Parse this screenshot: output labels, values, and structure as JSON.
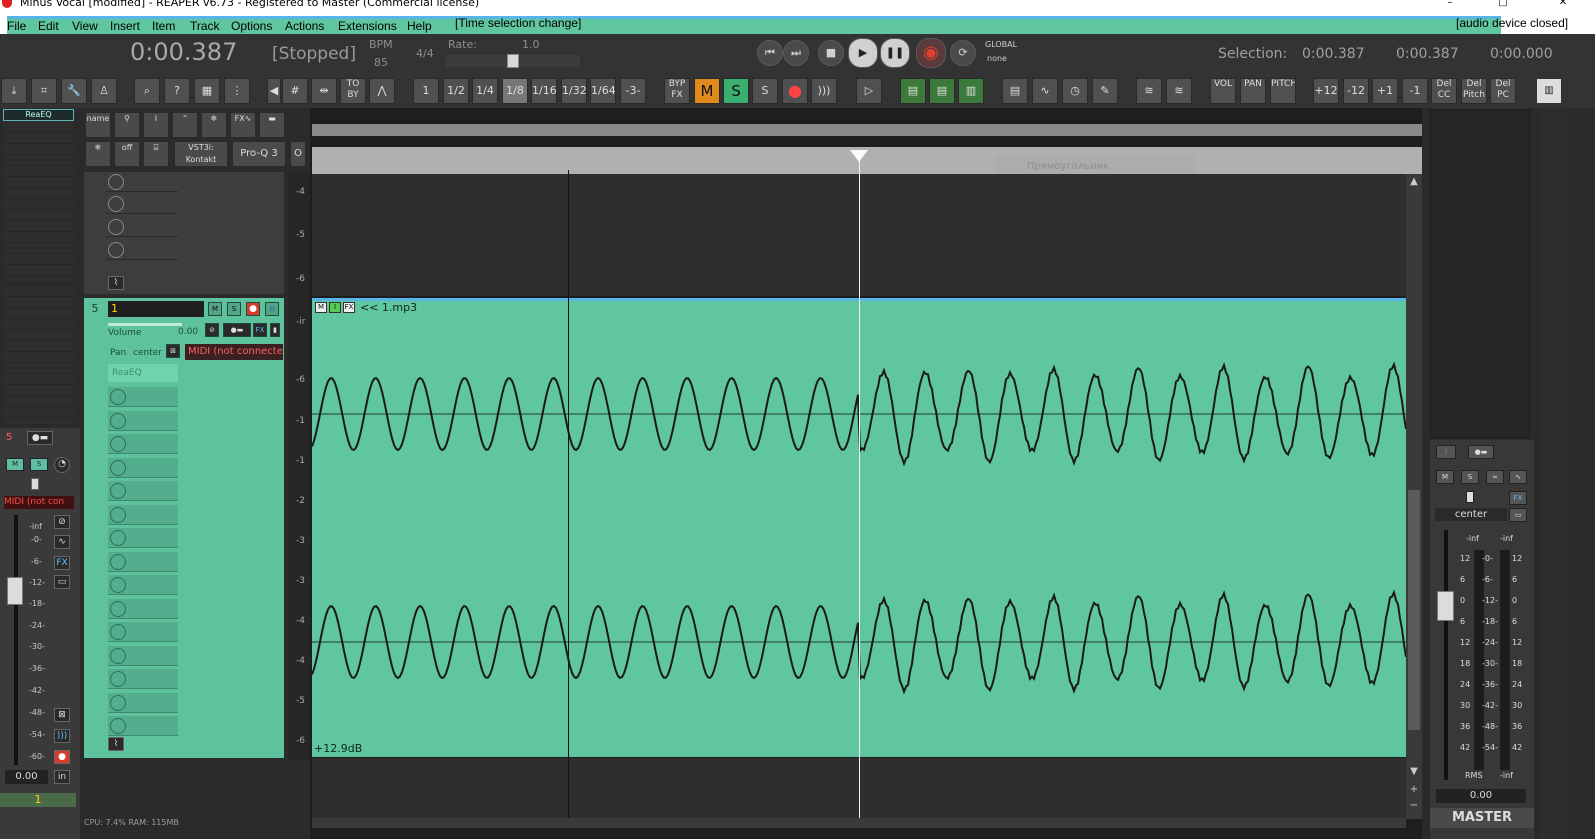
{
  "window": {
    "title": "Minus Vocal [modified] - REAPER v6.73 - Registered to Master (Commercial license)"
  },
  "menu": {
    "items": [
      "File",
      "Edit",
      "View",
      "Insert",
      "Item",
      "Track",
      "Options",
      "Actions",
      "Extensions",
      "Help"
    ],
    "status_left": "[Time selection change]",
    "status_right": "[audio device closed]"
  },
  "transport": {
    "time": "0:00.387",
    "state": "[Stopped]",
    "bpm_label": "BPM",
    "bpm": "85",
    "timesig": "4/4",
    "rate_label": "Rate:",
    "rate": "1.0",
    "global_label": "GLOBAL",
    "global_mode": "none",
    "selection_label": "Selection:",
    "selection_start": "0:00.387",
    "selection_end": "0:00.387",
    "selection_len": "0:00.000"
  },
  "toolbar": {
    "grid": [
      "1",
      "1/2",
      "1/4",
      "1/8",
      "1/16",
      "1/32",
      "1/64"
    ],
    "selected_grid": "1/8",
    "triplet": "-3-",
    "to_by": "TO BY",
    "byp": "BYP FX",
    "mute_all": "M",
    "solo_all": "S",
    "solo_excl": "S",
    "vol_label": "VOL",
    "pan_label": "PAN",
    "pitch_label": "PITCH",
    "pitch_buttons": [
      "+12",
      "-12",
      "+1",
      "-1"
    ],
    "del_buttons": [
      "Del CC",
      "Del Pitch",
      "Del PC"
    ]
  },
  "left_mixer": {
    "fx_slot": "ReaEQ",
    "track_number": "5",
    "midi_text": "MIDI (not con",
    "scale": [
      "-inf",
      "-0-",
      "-6-",
      "-12-",
      "-18-",
      "-24-",
      "-30-",
      "-36-",
      "-42-",
      "-48-",
      "-54-",
      "-60-"
    ],
    "volume": "0.00",
    "in_label": "in",
    "track_name": "1"
  },
  "tcp": {
    "name_label": "name",
    "vst_label": "VST3i: Kontakt",
    "proq_label": "Pro-Q 3",
    "off_label": "off",
    "o_label": "O",
    "track_number": "5",
    "track_name": "1",
    "volume_label": "Volume",
    "volume_value": "0.00",
    "pan_label": "Pan",
    "pan_value": "center",
    "midi_input": "MIDI (not connected",
    "fx_slot": "ReaEQ",
    "fx_label": "FX",
    "vu_ticks_top": [
      "-4",
      "-5",
      "-6"
    ],
    "vu_ticks_track": [
      "-ir",
      "-6",
      "-1",
      "-1",
      "-2",
      "-3",
      "-3",
      "-4",
      "-4",
      "-5",
      "-6"
    ]
  },
  "arrange": {
    "ghost_tooltip": "Прямоугольник",
    "item_name": "<< 1.mp3",
    "item_gain": "+12.9dB",
    "item_badges": [
      "M",
      "I",
      "FX"
    ]
  },
  "master": {
    "pan": "center",
    "peak_left": "-inf",
    "peak_right": "-inf",
    "scale_left": [
      "12",
      "6",
      "0",
      "6",
      "12",
      "18",
      "24",
      "30",
      "36",
      "42"
    ],
    "scale_mid": [
      "-0-",
      "-6-",
      "-12-",
      "-18-",
      "-24-",
      "-30-",
      "-36-",
      "-42-",
      "-48-",
      "-54-"
    ],
    "scale_right": [
      "12",
      "6",
      "0",
      "6",
      "12",
      "18",
      "24",
      "30",
      "36",
      "42"
    ],
    "rms_label": "RMS",
    "rms_value": "-inf",
    "volume": "0.00",
    "name": "MASTER",
    "fx_label": "FX"
  },
  "status": {
    "cpu": "CPU: 7.4% RAM: 115MB"
  },
  "colors": {
    "item_color": "#5fc6a0",
    "accent_blue": "#58b6e6",
    "mute_orange": "#e08a1e",
    "solo_green": "#3cae6e",
    "record_red": "#d83a2a"
  }
}
